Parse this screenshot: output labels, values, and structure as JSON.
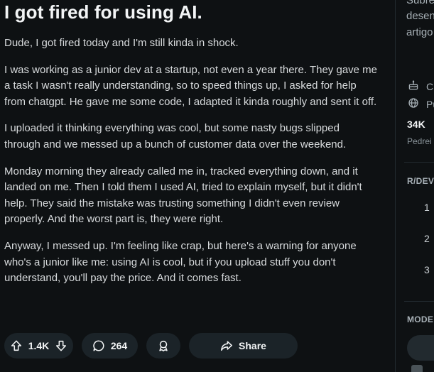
{
  "post": {
    "title": "I got fired for using AI.",
    "paragraphs": [
      "Dude, I got fired today and I'm still kinda in shock.",
      "I was working as a junior dev at a startup, not even a year there. They gave me a task I wasn't really understanding, so to speed things up, I asked for help from chatgpt. He gave me some code, I adapted it kinda roughly and sent it off.",
      "I uploaded it thinking everything was cool, but some nasty bugs slipped through and we messed up a bunch of customer data over the weekend.",
      "Monday morning they already called me in, tracked everything down, and it landed on me. Then I told them I used AI, tried to explain myself, but it didn't help. They said the mistake was trusting something I didn't even review properly. And the worst part is, they were right.",
      "Anyway, I messed up. I'm feeling like crap, but here's a warning for anyone who's a junior like me: using AI is cool, but if you upload stuff you don't understand, you'll pay the price. And it comes fast."
    ]
  },
  "actions": {
    "vote_count": "1.4K",
    "comment_count": "264",
    "share_label": "Share"
  },
  "sidebar": {
    "desc_lines": [
      "Subre",
      "desen",
      "artigo"
    ],
    "created_label": "Cr",
    "public_label": "Pu",
    "stat_value": "34K",
    "stat_label": "Pedrei",
    "rules_heading": "R/DEV",
    "rule_numbers": [
      "1",
      "2",
      "3"
    ],
    "mods_heading": "MODE"
  },
  "colors": {
    "background": "#0e1113",
    "button_bg": "#1b2328",
    "text": "#d7dadc"
  },
  "icons": {
    "upvote": "arrow-up-icon",
    "downvote": "arrow-down-icon",
    "comment": "comment-bubble-icon",
    "award": "award-ribbon-icon",
    "share": "share-arrow-icon",
    "created": "cake-icon",
    "public": "globe-icon"
  }
}
